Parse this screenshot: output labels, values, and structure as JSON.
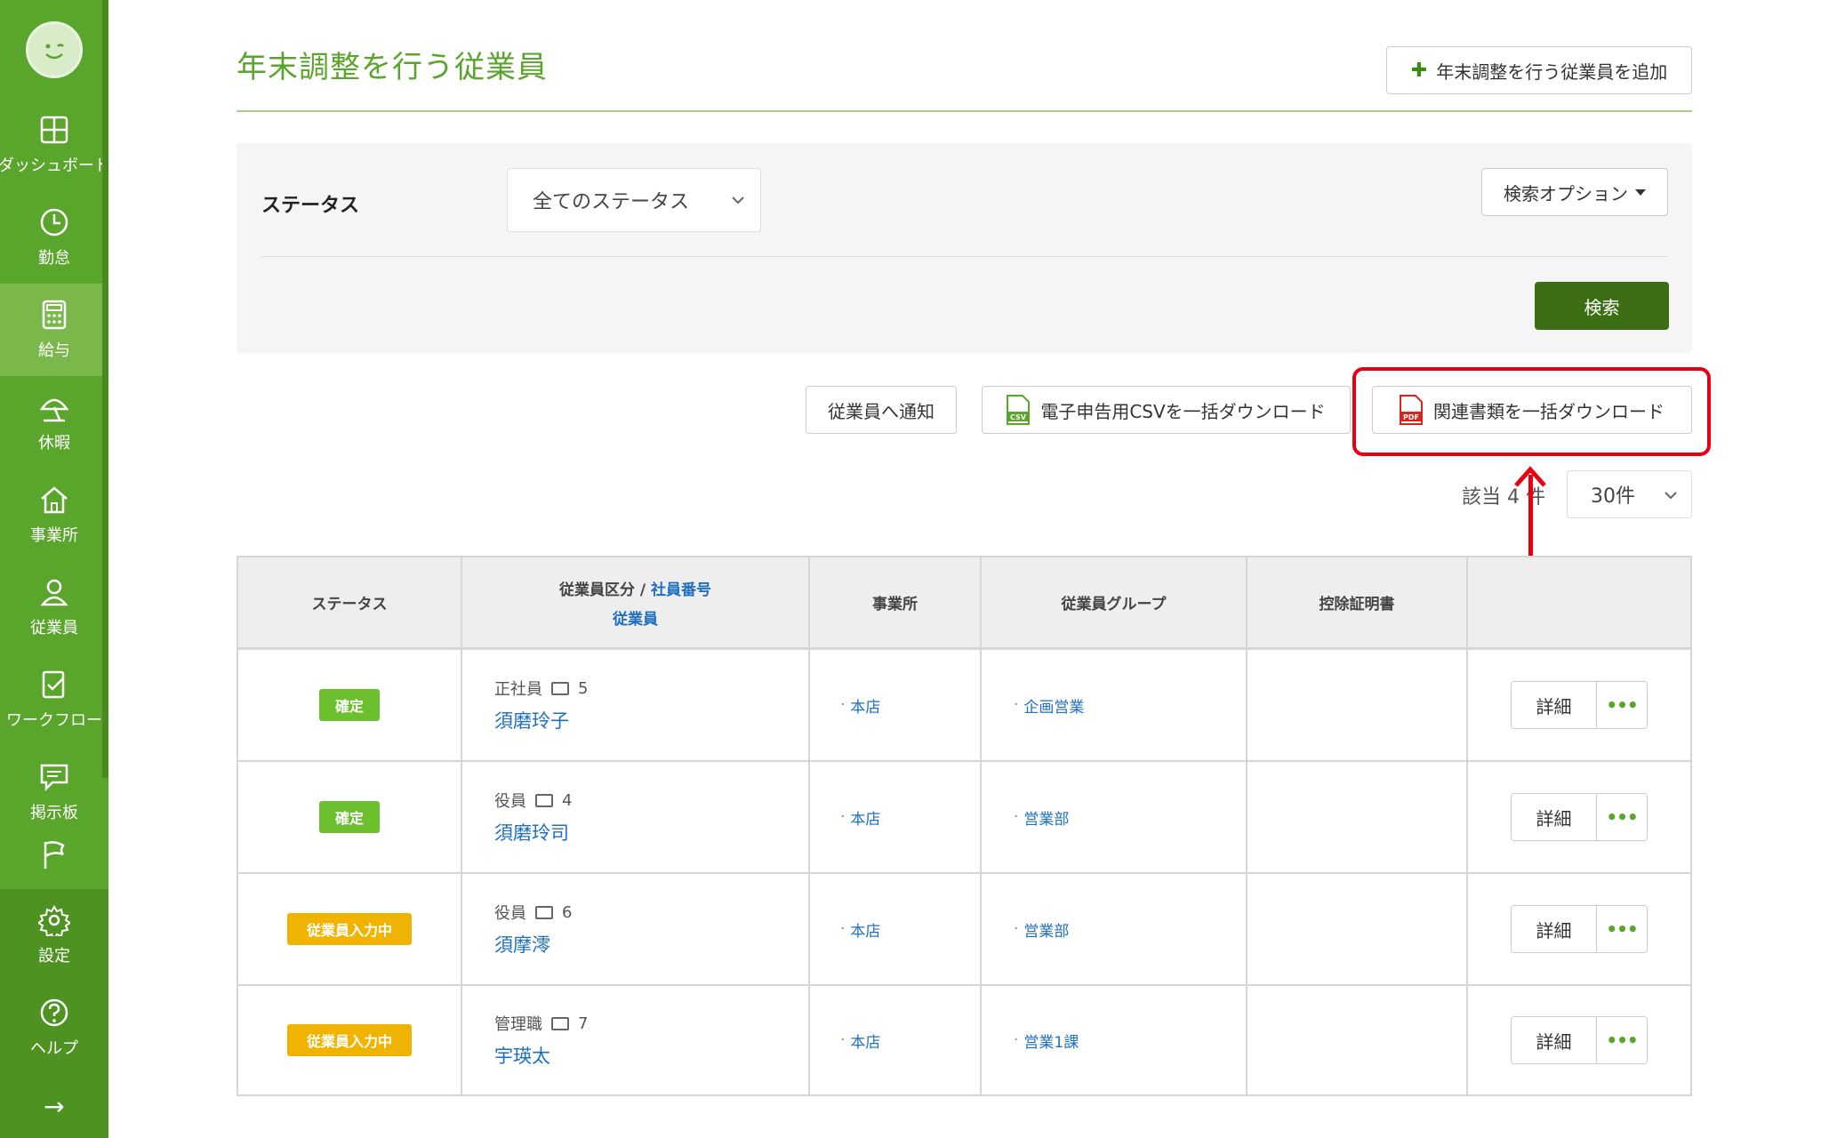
{
  "sidebar": {
    "items": [
      {
        "label": "ダッシュボード",
        "icon": "dashboard-icon"
      },
      {
        "label": "勤怠",
        "icon": "clock-icon"
      },
      {
        "label": "給与",
        "icon": "calculator-icon",
        "active": true
      },
      {
        "label": "休暇",
        "icon": "umbrella-icon"
      },
      {
        "label": "事業所",
        "icon": "home-icon"
      },
      {
        "label": "従業員",
        "icon": "person-icon"
      },
      {
        "label": "ワークフロー",
        "icon": "workflow-icon"
      },
      {
        "label": "掲示板",
        "icon": "message-icon"
      }
    ],
    "bottom": [
      {
        "label": "設定",
        "icon": "gear-icon"
      },
      {
        "label": "ヘルプ",
        "icon": "help-icon"
      }
    ],
    "collapse": "→"
  },
  "header": {
    "title": "年末調整を行う従業員",
    "add_button": "年末調整を行う従業員を追加"
  },
  "filter": {
    "status_label": "ステータス",
    "status_value": "全てのステータス",
    "search_options": "検索オプション",
    "search_button": "検索"
  },
  "actions": {
    "notify": "従業員へ通知",
    "csv_download": "電子申告用CSVを一括ダウンロード",
    "pdf_download": "関連書類を一括ダウンロード",
    "csv_badge": "CSV",
    "pdf_badge": "PDF"
  },
  "results": {
    "count": "該当 4 件",
    "per_page": "30件"
  },
  "table": {
    "headers": {
      "status": "ステータス",
      "employee_type": "従業員区分",
      "slash": "/",
      "employee_number": "社員番号",
      "employee": "従業員",
      "office": "事業所",
      "group": "従業員グループ",
      "certificate": "控除証明書"
    },
    "rows": [
      {
        "status": "確定",
        "status_type": "confirm",
        "type": "正社員",
        "number": "5",
        "name": "須磨玲子",
        "office": "本店",
        "group": "企画営業",
        "detail": "詳細",
        "more": "•••"
      },
      {
        "status": "確定",
        "status_type": "confirm",
        "type": "役員",
        "number": "4",
        "name": "須磨玲司",
        "office": "本店",
        "group": "営業部",
        "detail": "詳細",
        "more": "•••"
      },
      {
        "status": "従業員入力中",
        "status_type": "input",
        "type": "役員",
        "number": "6",
        "name": "須摩澪",
        "office": "本店",
        "group": "営業部",
        "detail": "詳細",
        "more": "•••"
      },
      {
        "status": "従業員入力中",
        "status_type": "input",
        "type": "管理職",
        "number": "7",
        "name": "宇瑛太",
        "office": "本店",
        "group": "営業1課",
        "detail": "詳細",
        "more": "•••"
      }
    ]
  },
  "colors": {
    "sidebar": "#5aa52b",
    "accent_green": "#5aa52b",
    "search_button": "#3c6e13",
    "link_blue": "#1f6fbf",
    "badge_confirm": "#6cbf2d",
    "badge_input": "#f0b400",
    "highlight_red": "#e60012"
  }
}
